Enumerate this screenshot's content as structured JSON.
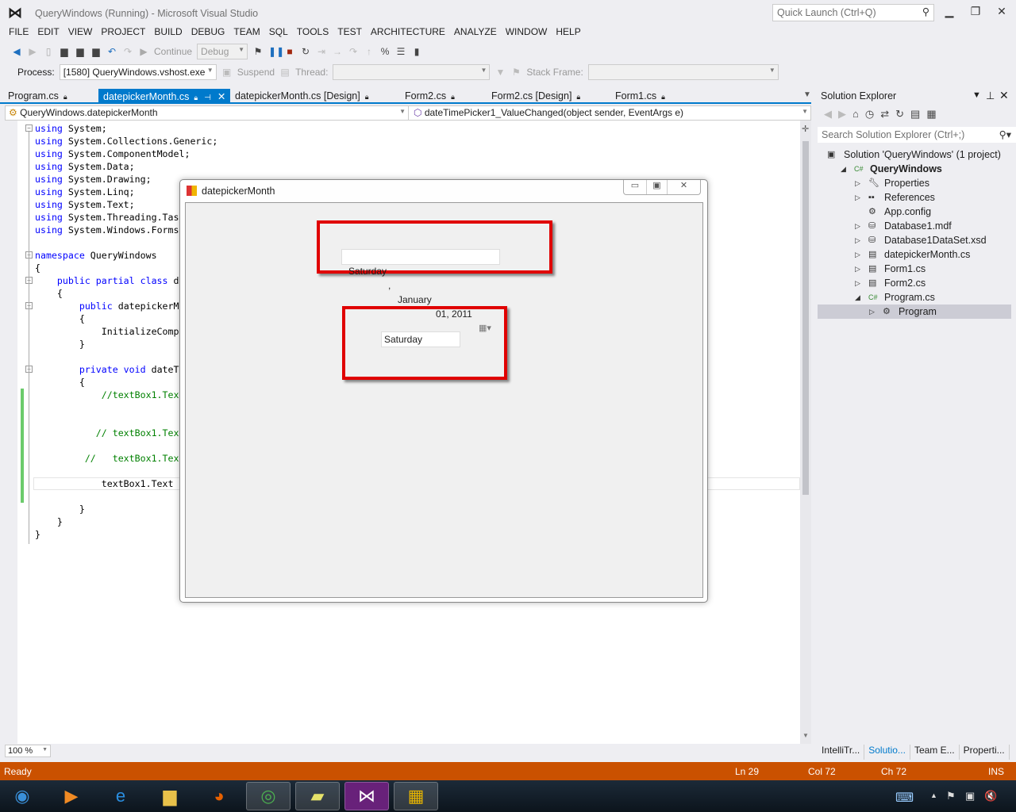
{
  "window": {
    "title": "QueryWindows (Running) - Microsoft Visual Studio",
    "quick_launch_placeholder": "Quick Launch (Ctrl+Q)"
  },
  "menu": [
    "FILE",
    "EDIT",
    "VIEW",
    "PROJECT",
    "BUILD",
    "DEBUG",
    "TEAM",
    "SQL",
    "TOOLS",
    "TEST",
    "ARCHITECTURE",
    "ANALYZE",
    "WINDOW",
    "HELP"
  ],
  "toolbar": {
    "continue": "Continue",
    "config": "Debug",
    "process_label": "Process:",
    "process_value": "[1580] QueryWindows.vshost.exe",
    "suspend": "Suspend",
    "thread_label": "Thread:",
    "stack_frame_label": "Stack Frame:"
  },
  "tabs": [
    {
      "label": "Program.cs",
      "active": false
    },
    {
      "label": "datepickerMonth.cs",
      "active": true
    },
    {
      "label": "datepickerMonth.cs [Design]",
      "active": false
    },
    {
      "label": "Form2.cs",
      "active": false
    },
    {
      "label": "Form2.cs [Design]",
      "active": false
    },
    {
      "label": "Form1.cs",
      "active": false
    }
  ],
  "navbar": {
    "type": "QueryWindows.datepickerMonth",
    "member": "dateTimePicker1_ValueChanged(object sender, EventArgs e)"
  },
  "code": [
    [
      [
        "k",
        "using"
      ],
      [
        "p",
        " System;"
      ]
    ],
    [
      [
        "k",
        "using"
      ],
      [
        "p",
        " System.Collections.Generic;"
      ]
    ],
    [
      [
        "k",
        "using"
      ],
      [
        "p",
        " System.ComponentModel;"
      ]
    ],
    [
      [
        "k",
        "using"
      ],
      [
        "p",
        " System.Data;"
      ]
    ],
    [
      [
        "k",
        "using"
      ],
      [
        "p",
        " System.Drawing;"
      ]
    ],
    [
      [
        "k",
        "using"
      ],
      [
        "p",
        " System.Linq;"
      ]
    ],
    [
      [
        "k",
        "using"
      ],
      [
        "p",
        " System.Text;"
      ]
    ],
    [
      [
        "k",
        "using"
      ],
      [
        "p",
        " System.Threading.Tas"
      ]
    ],
    [
      [
        "k",
        "using"
      ],
      [
        "p",
        " System.Windows.Forms"
      ]
    ],
    [],
    [
      [
        "k",
        "namespace"
      ],
      [
        "p",
        " QueryWindows"
      ]
    ],
    [
      [
        "p",
        "{"
      ]
    ],
    [
      [
        "p",
        "    "
      ],
      [
        "k",
        "public partial class"
      ],
      [
        "p",
        " d"
      ]
    ],
    [
      [
        "p",
        "    {"
      ]
    ],
    [
      [
        "p",
        "        "
      ],
      [
        "k",
        "public"
      ],
      [
        "p",
        " datepickerM"
      ]
    ],
    [
      [
        "p",
        "        {"
      ]
    ],
    [
      [
        "p",
        "            InitializeComp"
      ]
    ],
    [
      [
        "p",
        "        }"
      ]
    ],
    [],
    [
      [
        "p",
        "        "
      ],
      [
        "k",
        "private void"
      ],
      [
        "p",
        " dateT"
      ]
    ],
    [
      [
        "p",
        "        {"
      ]
    ],
    [
      [
        "c",
        "            //textBox1.Tex"
      ]
    ],
    [],
    [],
    [
      [
        "c",
        "           // textBox1.Tex"
      ]
    ],
    [],
    [
      [
        "c",
        "         //   textBox1.Tex"
      ]
    ],
    [],
    [
      [
        "p",
        "            textBox1.Text"
      ]
    ],
    [],
    [
      [
        "p",
        "        }"
      ]
    ],
    [
      [
        "p",
        "    }"
      ]
    ],
    [
      [
        "p",
        "}"
      ]
    ]
  ],
  "editor": {
    "zoom": "100 %"
  },
  "dialog": {
    "title": "datepickerMonth",
    "dtp_day": "Saturday",
    "dtp_sep": ",",
    "dtp_month": "January",
    "dtp_date": "01, 2011",
    "textbox_value": "Saturday"
  },
  "solution_explorer": {
    "title": "Solution Explorer",
    "search_placeholder": "Search Solution Explorer (Ctrl+;)",
    "items": [
      {
        "label": "Solution 'QueryWindows' (1 project)",
        "icon": "solution-icon",
        "expander": ""
      },
      {
        "label": "QueryWindows",
        "icon": "csharp-project-icon",
        "expander": "expanded",
        "bold": true
      },
      {
        "label": "Properties",
        "icon": "wrench-icon",
        "expander": "collapsed"
      },
      {
        "label": "References",
        "icon": "references-icon",
        "expander": "collapsed"
      },
      {
        "label": "App.config",
        "icon": "config-icon",
        "expander": ""
      },
      {
        "label": "Database1.mdf",
        "icon": "database-icon",
        "expander": "collapsed"
      },
      {
        "label": "Database1DataSet.xsd",
        "icon": "dataset-icon",
        "expander": "collapsed"
      },
      {
        "label": "datepickerMonth.cs",
        "icon": "form-icon",
        "expander": "collapsed"
      },
      {
        "label": "Form1.cs",
        "icon": "form-icon",
        "expander": "collapsed"
      },
      {
        "label": "Form2.cs",
        "icon": "form-icon",
        "expander": "collapsed"
      },
      {
        "label": "Program.cs",
        "icon": "csharp-file-icon",
        "expander": "expanded"
      },
      {
        "label": "Program",
        "icon": "class-icon",
        "expander": "collapsed",
        "selected": true
      }
    ],
    "bottom_tabs": [
      "IntelliTr...",
      "Solutio...",
      "Team E...",
      "Properti..."
    ]
  },
  "status": {
    "text": "Ready",
    "ln": "Ln 29",
    "col": "Col 72",
    "ch": "Ch 72",
    "mode": "INS"
  },
  "taskbar": [
    "start-orb-icon",
    "media-player-icon",
    "internet-explorer-icon",
    "file-explorer-icon",
    "firefox-icon",
    "chrome-icon",
    "sticky-notes-icon",
    "visual-studio-icon",
    "winforms-app-icon"
  ],
  "colors": {
    "accent": "#007acc",
    "status_bar": "#ca5100",
    "highlight_box": "#e00000"
  }
}
